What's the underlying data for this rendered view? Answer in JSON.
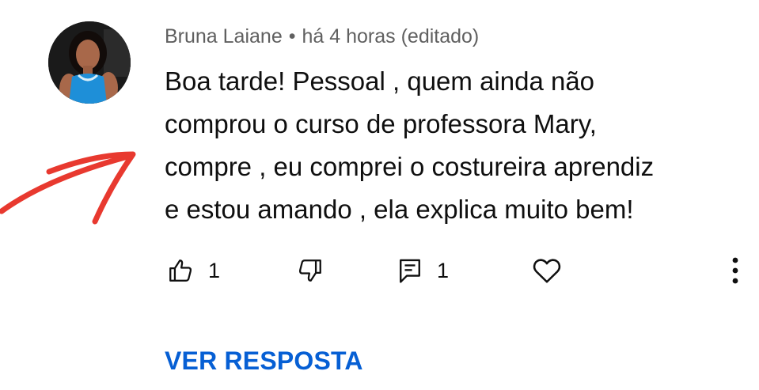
{
  "comment": {
    "author": "Bruna Laiane",
    "separator": "•",
    "time": "há 4 horas (editado)",
    "text_lines": [
      "Boa tarde! Pessoal , quem ainda não",
      "comprou o curso de professora Mary,",
      "compre , eu comprei o costureira aprendiz",
      "e estou amando , ela explica muito bem!"
    ],
    "likes": "1",
    "replies": "1",
    "reply_link": "VER RESPOSTA"
  },
  "icons": {
    "like": "thumbs-up-icon",
    "dislike": "thumbs-down-icon",
    "reply": "comment-icon",
    "heart": "heart-icon",
    "more": "more-vertical-icon",
    "annotation": "red-arrow-icon"
  },
  "colors": {
    "meta": "#606060",
    "text": "#0f0f0f",
    "link": "#065fd4",
    "arrow": "#e8392f",
    "dress": "#1e8fd8"
  }
}
